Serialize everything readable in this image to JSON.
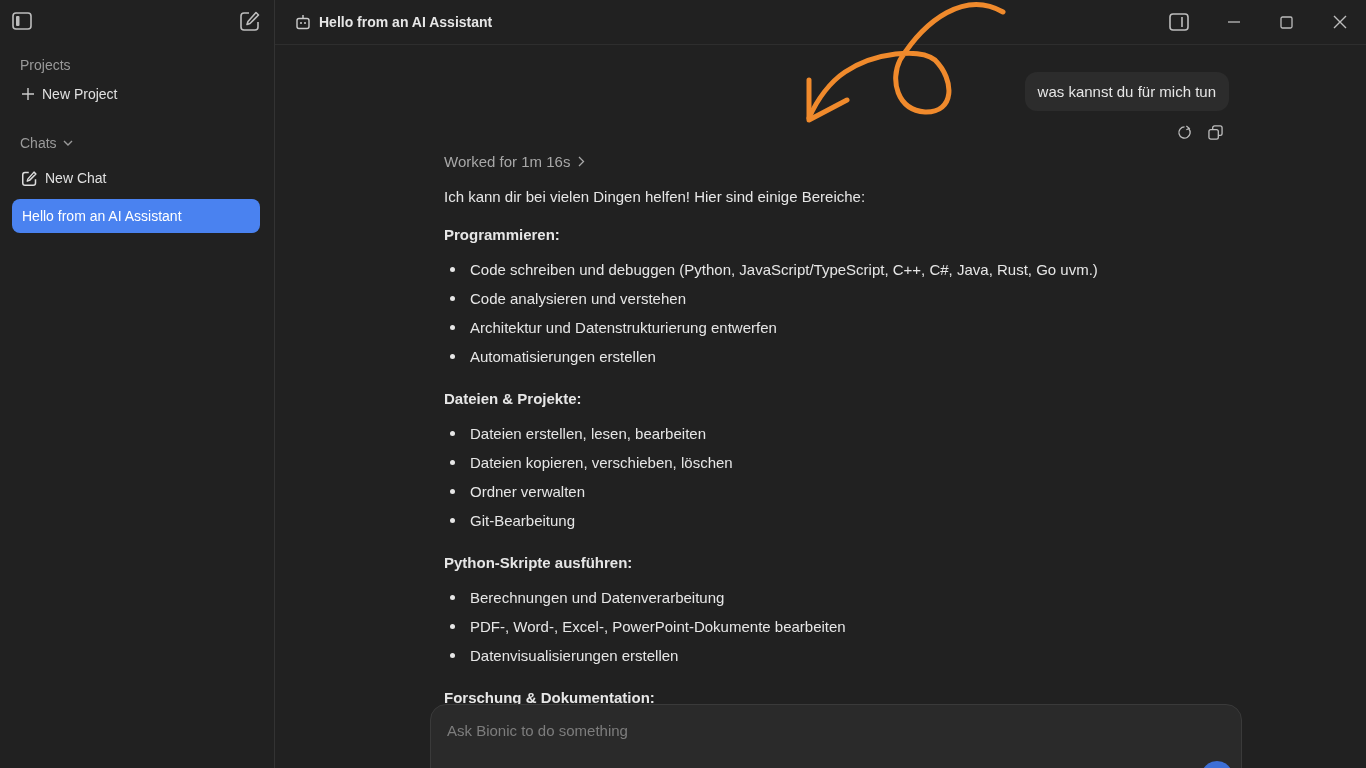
{
  "sidebar": {
    "projects_label": "Projects",
    "new_project": "New Project",
    "chats_label": "Chats",
    "chats_expanded": true,
    "new_chat": "New Chat",
    "chats": [
      {
        "title": "Hello from an AI Assistant",
        "selected": true
      }
    ]
  },
  "header": {
    "title": "Hello from an AI Assistant"
  },
  "conversation": {
    "user_message": "was kannst du für mich tun",
    "worked": "Worked for 1m 16s",
    "intro": "Ich kann dir bei vielen Dingen helfen! Hier sind einige Bereiche:",
    "sections": [
      {
        "heading": "Programmieren:",
        "items": [
          "Code schreiben und debuggen (Python, JavaScript/TypeScript, C++, C#, Java, Rust, Go uvm.)",
          "Code analysieren und verstehen",
          "Architektur und Datenstrukturierung entwerfen",
          "Automatisierungen erstellen"
        ]
      },
      {
        "heading": "Dateien & Projekte:",
        "items": [
          "Dateien erstellen, lesen, bearbeiten",
          "Dateien kopieren, verschieben, löschen",
          "Ordner verwalten",
          "Git-Bearbeitung"
        ]
      },
      {
        "heading": "Python-Skripte ausführen:",
        "items": [
          "Berechnungen und Datenverarbeitung",
          "PDF-, Word-, Excel-, PowerPoint-Dokumente bearbeiten",
          "Datenvisualisierungen erstellen"
        ]
      },
      {
        "heading": "Forschung & Dokumentation:"
      }
    ]
  },
  "composer": {
    "placeholder": "Ask Bionic to do something"
  }
}
